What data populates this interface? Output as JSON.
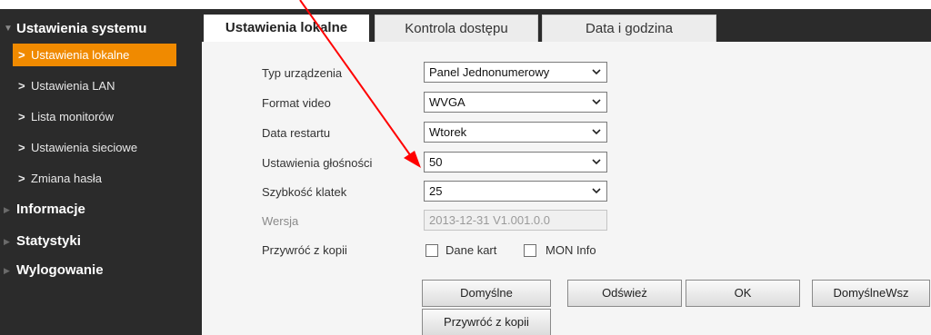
{
  "sidebar": {
    "sections": [
      {
        "label": "Ustawienia systemu"
      },
      {
        "label": "Informacje"
      },
      {
        "label": "Statystyki"
      },
      {
        "label": "Wylogowanie"
      }
    ],
    "items": [
      {
        "label": "Ustawienia lokalne"
      },
      {
        "label": "Ustawienia LAN"
      },
      {
        "label": "Lista monitorów"
      },
      {
        "label": "Ustawienia sieciowe"
      },
      {
        "label": "Zmiana hasła"
      }
    ]
  },
  "tabs": [
    {
      "label": "Ustawienia lokalne"
    },
    {
      "label": "Kontrola dostępu"
    },
    {
      "label": "Data i godzina"
    }
  ],
  "form": {
    "device_type": {
      "label": "Typ urządzenia",
      "value": "Panel Jednonumerowy"
    },
    "video_format": {
      "label": "Format video",
      "value": "WVGA"
    },
    "restart_date": {
      "label": "Data restartu",
      "value": "Wtorek"
    },
    "volume": {
      "label": "Ustawienia głośności",
      "value": "50"
    },
    "frame_rate": {
      "label": "Szybkość klatek",
      "value": "25"
    },
    "version": {
      "label": "Wersja",
      "value": "2013-12-31 V1.001.0.0"
    },
    "restore": {
      "label": "Przywróć z kopii",
      "opt1": "Dane kart",
      "opt2": "MON Info"
    }
  },
  "buttons": {
    "default": "Domyślne",
    "refresh": "Odśwież",
    "ok": "OK",
    "default_all": "DomyślneWsz",
    "restore": "Przywróć z kopii"
  },
  "colors": {
    "sidebar_bg": "#2b2b2b",
    "active_item": "#f08a00",
    "annotation_arrow": "#ff0000"
  }
}
